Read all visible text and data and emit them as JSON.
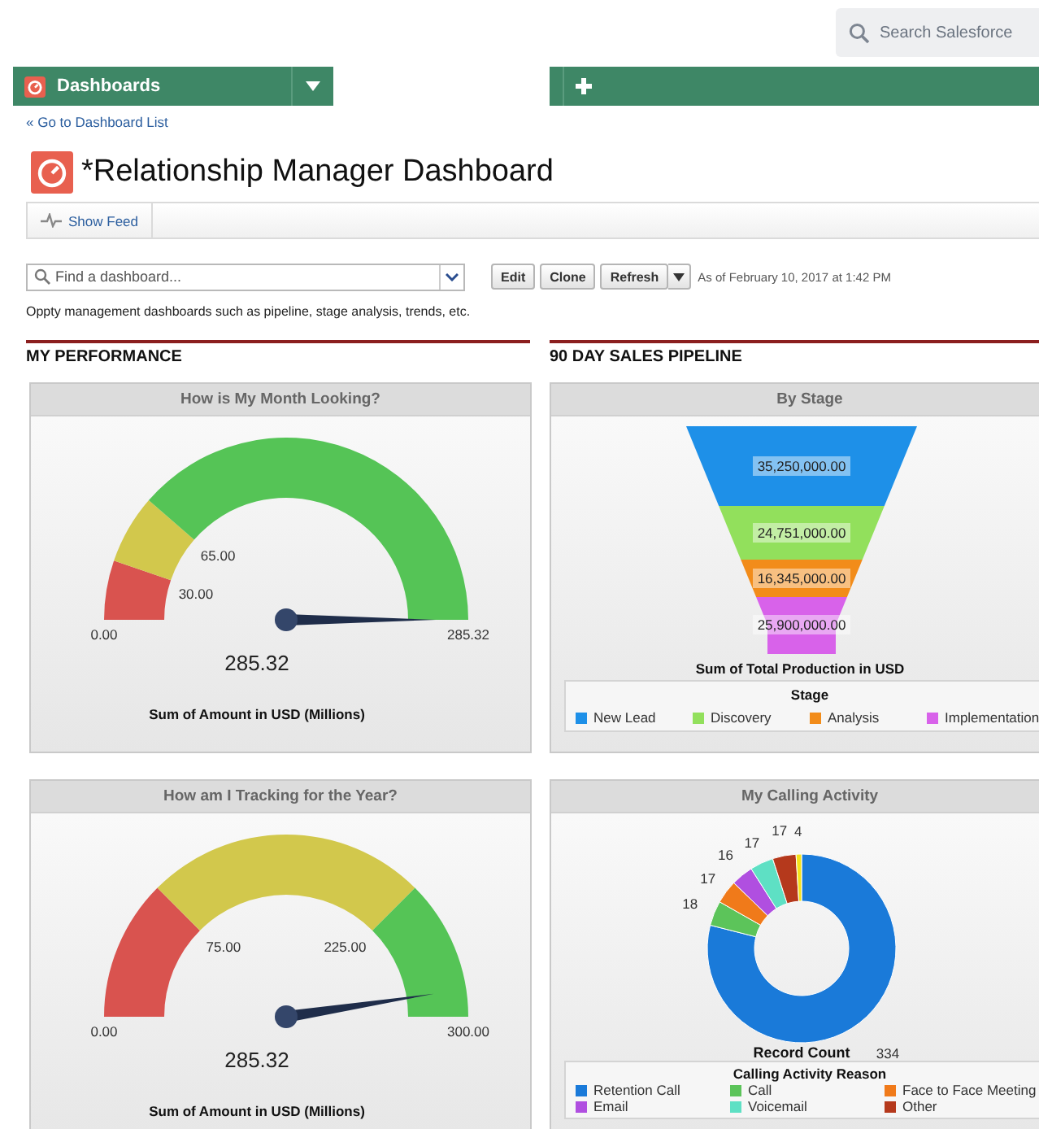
{
  "search": {
    "placeholder": "Search Salesforce"
  },
  "nav": {
    "tab": "Dashboards"
  },
  "back_link": "« Go to Dashboard List",
  "title": "*Relationship Manager Dashboard",
  "feed_button": "Show Feed",
  "find": {
    "placeholder": "Find a dashboard..."
  },
  "buttons": [
    "Edit",
    "Clone",
    "Refresh"
  ],
  "timestamp": "As of February 10, 2017 at 1:42 PM",
  "description": "Oppty management dashboards such as pipeline, stage analysis, trends, etc.",
  "columns": [
    {
      "heading": "MY PERFORMANCE",
      "components": [
        {
          "kind": "gauge",
          "title": "How is My Month Looking?",
          "min_label": "0.00",
          "max_label": "285.32",
          "value": "285.32",
          "footer": "Sum of Amount in USD (Millions)",
          "bands": [
            {
              "color": "#d9534f",
              "label": "30.00"
            },
            {
              "color": "#d2c84c",
              "label": "65.00"
            },
            {
              "color": "#55c456"
            }
          ]
        },
        {
          "kind": "gauge",
          "title": "How am I Tracking for the Year?",
          "min_label": "0.00",
          "max_label": "300.00",
          "value": "285.32",
          "footer": "Sum of Amount in USD (Millions)",
          "bands": [
            {
              "color": "#d9534f",
              "label": "75.00"
            },
            {
              "color": "#d2c84c",
              "label": "225.00"
            },
            {
              "color": "#55c456"
            }
          ]
        }
      ]
    },
    {
      "heading": "90 DAY SALES PIPELINE",
      "components": [
        {
          "kind": "funnel",
          "title": "By Stage",
          "xlabel": "Sum of Total Production in USD",
          "legend_title": "Stage",
          "segments": [
            {
              "label": "35,250,000.00",
              "color": "#1e90e8"
            },
            {
              "label": "24,751,000.00",
              "color": "#92e05c"
            },
            {
              "label": "16,345,000.00",
              "color": "#f28c1a"
            },
            {
              "label": "25,900,000.00",
              "color": "#d862ea"
            }
          ],
          "legend": [
            {
              "name": "New Lead",
              "color": "#1e90e8"
            },
            {
              "name": "Discovery",
              "color": "#92e05c"
            },
            {
              "name": "Analysis",
              "color": "#f28c1a"
            },
            {
              "name": "Implementation",
              "color": "#d862ea"
            }
          ]
        },
        {
          "kind": "donut",
          "title": "My Calling Activity",
          "legend_title": "Calling Activity Reason",
          "chart_data": {
            "type": "donut",
            "xlabel": "Record Count",
            "values": [
              334,
              18,
              17,
              16,
              17,
              17,
              4
            ],
            "colors": [
              "#1a7ad9",
              "#5cc45a",
              "#f07a1a",
              "#b04fe0",
              "#5ee0c4",
              "#b5391c",
              "#f5e21a"
            ],
            "data_labels": true
          },
          "legend": [
            {
              "name": "Retention Call",
              "color": "#1a7ad9"
            },
            {
              "name": "Call",
              "color": "#5cc45a"
            },
            {
              "name": "Face to Face Meeting",
              "color": "#f07a1a"
            },
            {
              "name": "Email",
              "color": "#b04fe0"
            },
            {
              "name": "Voicemail",
              "color": "#5ee0c4"
            },
            {
              "name": "Other",
              "color": "#b5391c"
            }
          ]
        }
      ]
    }
  ]
}
